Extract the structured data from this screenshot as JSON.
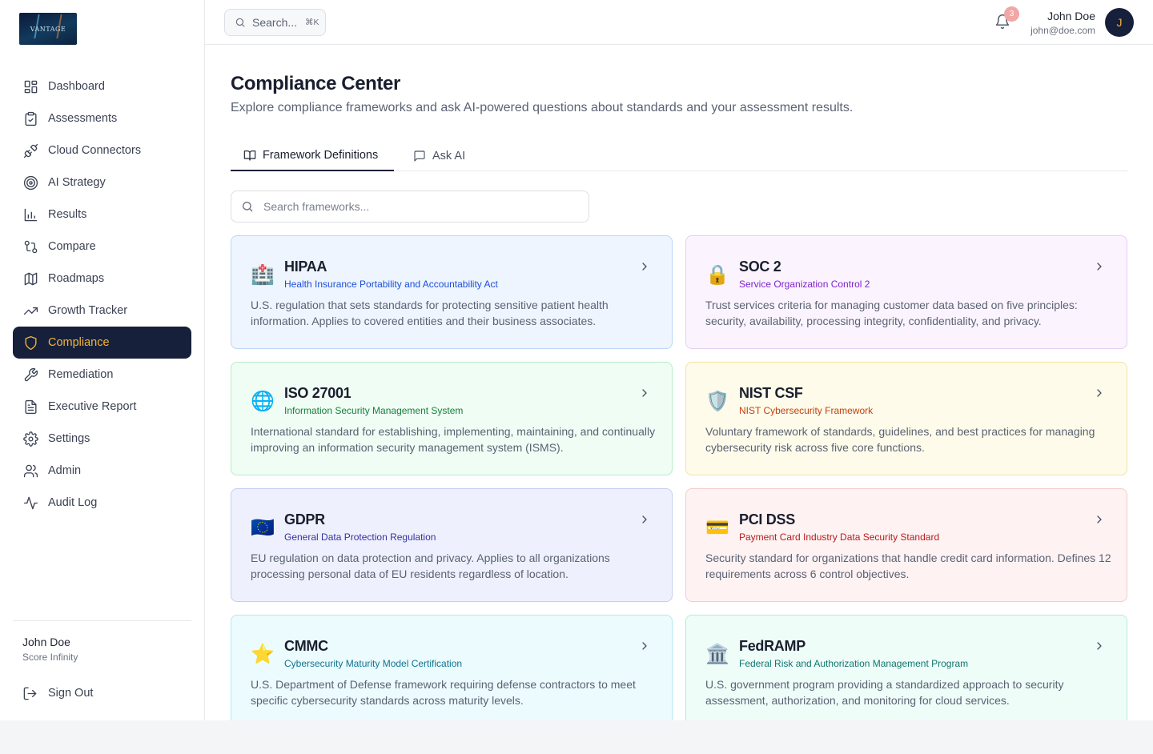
{
  "brand": {
    "logo_text": "VANTAGE"
  },
  "search": {
    "label": "Search...",
    "shortcut": "⌘K"
  },
  "notifications": {
    "count": "3"
  },
  "user": {
    "name": "John Doe",
    "email": "john@doe.com",
    "initial": "J",
    "org": "Score Infinity"
  },
  "sidebar": {
    "items": [
      {
        "label": "Dashboard",
        "icon": "dashboard-icon"
      },
      {
        "label": "Assessments",
        "icon": "clipboard-icon"
      },
      {
        "label": "Cloud Connectors",
        "icon": "plug-icon"
      },
      {
        "label": "AI Strategy",
        "icon": "target-icon"
      },
      {
        "label": "Results",
        "icon": "bar-chart-icon"
      },
      {
        "label": "Compare",
        "icon": "git-compare-icon"
      },
      {
        "label": "Roadmaps",
        "icon": "map-icon"
      },
      {
        "label": "Growth Tracker",
        "icon": "trending-up-icon"
      },
      {
        "label": "Compliance",
        "icon": "shield-icon",
        "active": true
      },
      {
        "label": "Remediation",
        "icon": "wrench-icon"
      },
      {
        "label": "Executive Report",
        "icon": "file-text-icon"
      },
      {
        "label": "Settings",
        "icon": "gear-icon"
      },
      {
        "label": "Admin",
        "icon": "users-icon"
      },
      {
        "label": "Audit Log",
        "icon": "activity-icon"
      }
    ],
    "sign_out": "Sign Out"
  },
  "page": {
    "title": "Compliance Center",
    "subtitle": "Explore compliance frameworks and ask AI-powered questions about standards and your assessment results."
  },
  "tabs": [
    {
      "label": "Framework Definitions",
      "icon": "book-icon",
      "active": true
    },
    {
      "label": "Ask AI",
      "icon": "message-icon"
    }
  ],
  "framework_search": {
    "placeholder": "Search frameworks..."
  },
  "frameworks": [
    {
      "emoji": "🏥",
      "name": "HIPAA",
      "full": "Health Insurance Portability and Accountability Act",
      "desc": "U.S. regulation that sets standards for protecting sensitive patient health information. Applies to covered entities and their business associates.",
      "bg": "#eef5fe",
      "border": "#bcd6f5",
      "accent": "#1d4ed8"
    },
    {
      "emoji": "🔒",
      "name": "SOC 2",
      "full": "Service Organization Control 2",
      "desc": "Trust services criteria for managing customer data based on five principles: security, availability, processing integrity, confidentiality, and privacy.",
      "bg": "#fbf4fe",
      "border": "#e7cdf5",
      "accent": "#7e22ce"
    },
    {
      "emoji": "🌐",
      "name": "ISO 27001",
      "full": "Information Security Management System",
      "desc": "International standard for establishing, implementing, maintaining, and continually improving an information security management system (ISMS).",
      "bg": "#effdf4",
      "border": "#b9ecc9",
      "accent": "#15803d"
    },
    {
      "emoji": "🛡️",
      "name": "NIST CSF",
      "full": "NIST Cybersecurity Framework",
      "desc": "Voluntary framework of standards, guidelines, and best practices for managing cybersecurity risk across five core functions.",
      "bg": "#fefbea",
      "border": "#f3e3a0",
      "accent": "#c2410c"
    },
    {
      "emoji": "🇪🇺",
      "name": "GDPR",
      "full": "General Data Protection Regulation",
      "desc": "EU regulation on data protection and privacy. Applies to all organizations processing personal data of EU residents regardless of location.",
      "bg": "#eef1fd",
      "border": "#c5cdf2",
      "accent": "#3730a3"
    },
    {
      "emoji": "💳",
      "name": "PCI DSS",
      "full": "Payment Card Industry Data Security Standard",
      "desc": "Security standard for organizations that handle credit card information. Defines 12 requirements across 6 control objectives.",
      "bg": "#fef2f2",
      "border": "#f5cccc",
      "accent": "#b91c1c"
    },
    {
      "emoji": "⭐",
      "name": "CMMC",
      "full": "Cybersecurity Maturity Model Certification",
      "desc": "U.S. Department of Defense framework requiring defense contractors to meet specific cybersecurity standards across maturity levels.",
      "bg": "#ecfbfe",
      "border": "#b5e7f2",
      "accent": "#0e7490"
    },
    {
      "emoji": "🏛️",
      "name": "FedRAMP",
      "full": "Federal Risk and Authorization Management Program",
      "desc": "U.S. government program providing a standardized approach to security assessment, authorization, and monitoring for cloud services.",
      "bg": "#effdf9",
      "border": "#b2ecdd",
      "accent": "#0f766e"
    }
  ]
}
